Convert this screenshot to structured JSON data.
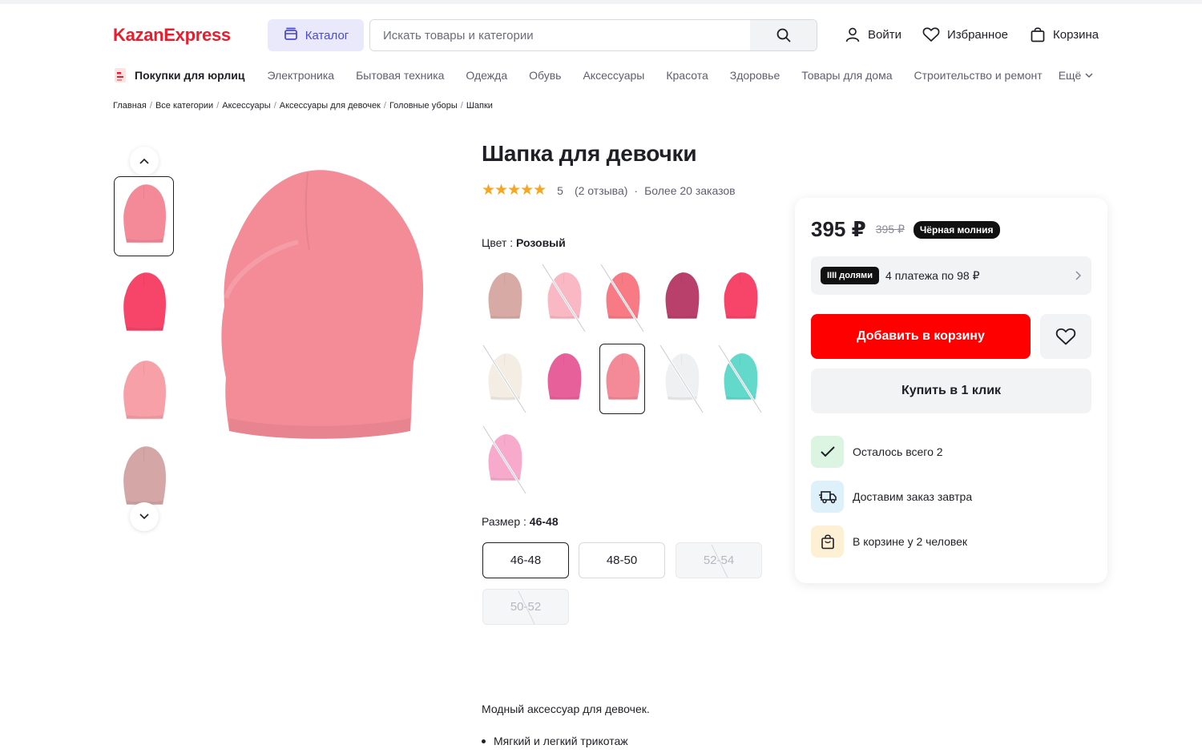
{
  "header": {
    "logo": "KazanExpress",
    "catalog_label": "Каталог",
    "search_placeholder": "Искать товары и категории",
    "login_label": "Войти",
    "favorites_label": "Избранное",
    "cart_label": "Корзина"
  },
  "nav": {
    "legal": "Покупки для юрлиц",
    "items": [
      "Электроника",
      "Бытовая техника",
      "Одежда",
      "Обувь",
      "Аксессуары",
      "Красота",
      "Здоровье",
      "Товары для дома",
      "Строительство и ремонт"
    ],
    "more": "Ещё"
  },
  "breadcrumbs": [
    "Главная",
    "Все категории",
    "Аксессуары",
    "Аксессуары для девочек",
    "Головные уборы",
    "Шапки"
  ],
  "product": {
    "title": "Шапка для девочки",
    "rating": "5",
    "reviews": "(2 отзыва)",
    "orders": "Более 20 заказов",
    "color_label": "Цвет : ",
    "color_value": "Розовый",
    "size_label": "Размер : ",
    "size_value": "46-48",
    "thumbnails": [
      {
        "color": "#f48a97"
      },
      {
        "color": "#f7456a"
      },
      {
        "color": "#f7a0a8"
      },
      {
        "color": "#d4a6a6"
      }
    ],
    "main_image_color": "#f48c97",
    "swatches": [
      {
        "color": "#d8aaa5",
        "available": true
      },
      {
        "color": "#f9b8c3",
        "available": false
      },
      {
        "color": "#f77a85",
        "available": false
      },
      {
        "color": "#b8406a",
        "available": true
      },
      {
        "color": "#f7456a",
        "available": true
      },
      {
        "color": "#f3ede3",
        "available": false
      },
      {
        "color": "#e8609a",
        "available": true
      },
      {
        "color": "#f48a97",
        "available": true,
        "selected": true
      },
      {
        "color": "#eef0f2",
        "available": false
      },
      {
        "color": "#63d9cc",
        "available": false
      },
      {
        "color": "#f7aacb",
        "available": false
      }
    ],
    "sizes": [
      {
        "label": "46-48",
        "state": "selected"
      },
      {
        "label": "48-50",
        "state": "available"
      },
      {
        "label": "52-54",
        "state": "disabled"
      },
      {
        "label": "50-52",
        "state": "disabled"
      }
    ],
    "description": "Модный аксессуар для девочек.",
    "bullets": [
      "Мягкий и легкий трикотаж"
    ]
  },
  "buy_card": {
    "price": "395 ₽",
    "old_price": "395 ₽",
    "promo": "Чёрная молния",
    "installment_tag": "IIII долями",
    "installment_text": "4 платежа по 98 ₽",
    "add_to_cart": "Добавить в корзину",
    "buy_one_click": "Купить в 1 клик",
    "features": [
      {
        "text": "Осталось всего 2",
        "icon": "check-icon",
        "bg": "#dcf5e3"
      },
      {
        "text": "Доставим заказ завтра",
        "icon": "truck-icon",
        "bg": "#def1fb"
      },
      {
        "text": "В корзине у 2 человек",
        "icon": "bag-icon",
        "bg": "#fdf0d4"
      }
    ]
  },
  "colors": {
    "brand": "#e81d2d",
    "accent_button": "#ff0000",
    "catalog_bg": "#e9e9fb",
    "catalog_text": "#4a4ad6",
    "star": "#f5a623"
  }
}
